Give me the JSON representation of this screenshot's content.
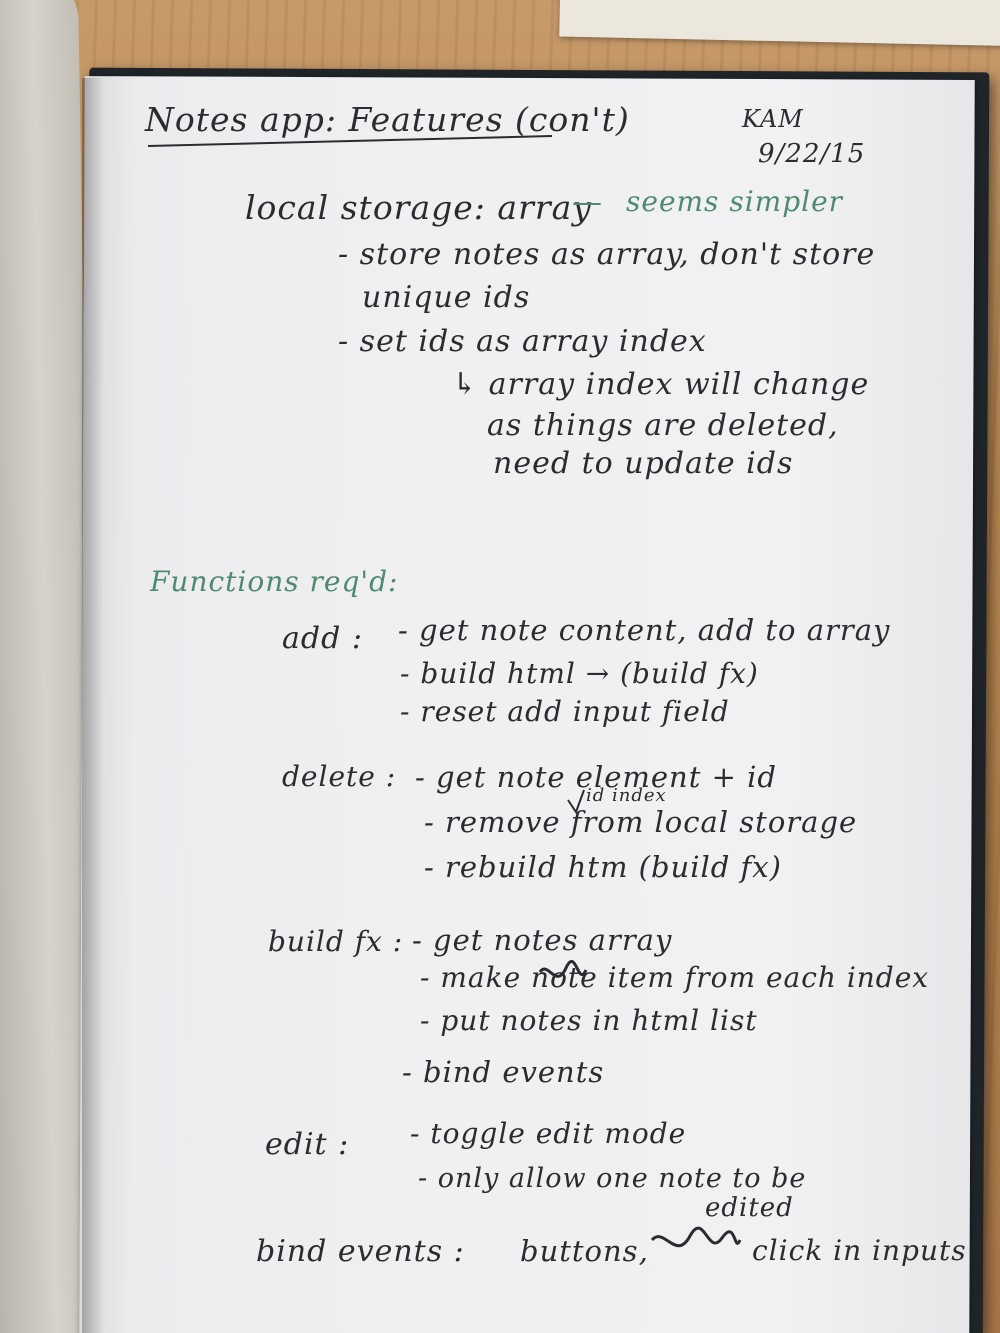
{
  "notes": {
    "title": "Notes app: Features (con't)",
    "author": "KAM",
    "date": "9/22/15",
    "storage": {
      "heading": "local storage: array",
      "dash": "—",
      "aside": "seems simpler",
      "points": [
        "- store notes as array, don't store",
        "unique ids",
        "- set ids as array index"
      ],
      "subnote": [
        "↳ array index will change",
        "as things are deleted,",
        "need to update ids"
      ]
    },
    "functions_heading": "Functions req'd:",
    "functions": {
      "add": {
        "label": "add :",
        "items": [
          "- get note content, add to array",
          "- build html → (build fx)",
          "- reset add input field"
        ]
      },
      "delete": {
        "label": "delete :",
        "items": [
          "- get note element + id",
          "- remove from local storage",
          "- rebuild htm (build fx)"
        ],
        "insert": "id index"
      },
      "buildfx": {
        "label": "build fx :",
        "items": [
          "- get notes array",
          "- make note item from each index",
          "- put notes in html list",
          "- bind events"
        ]
      },
      "edit": {
        "label": "edit :",
        "items": [
          "- toggle edit mode",
          "- only allow one note to be",
          "edited"
        ]
      },
      "bind": {
        "label": "bind events :",
        "items": [
          "buttons,",
          "click in inputs"
        ]
      }
    }
  }
}
